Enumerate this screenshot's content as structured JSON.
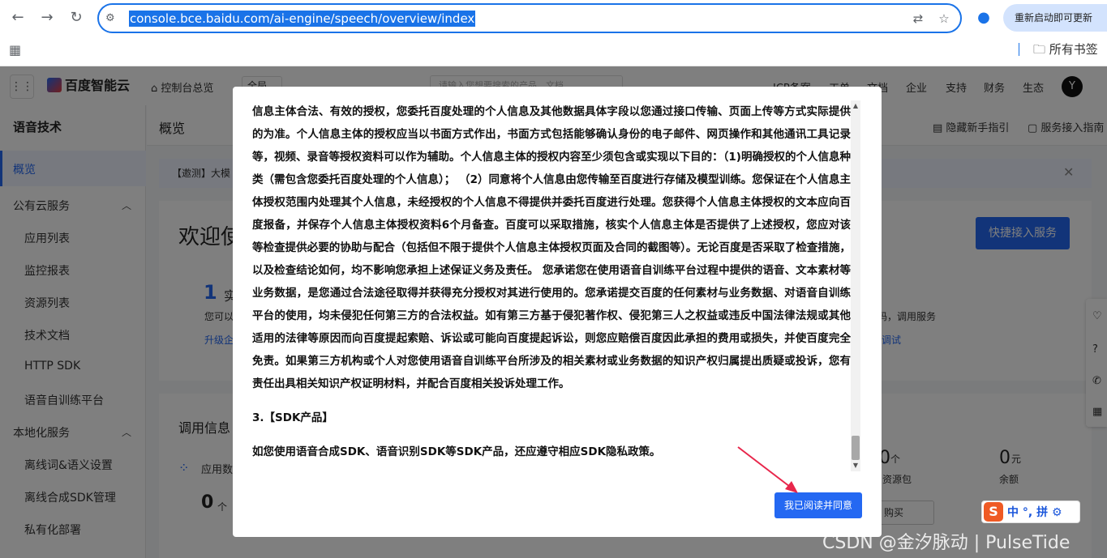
{
  "browser": {
    "url": "console.bce.baidu.com/ai-engine/speech/overview/index",
    "restart_label": "重新启动即可更新",
    "bookmarks_folder": "所有书签"
  },
  "topnav": {
    "brand": "百度智能云",
    "console_home": "控制台总览",
    "global_label": "全局",
    "search_placeholder": "请输入您想要搜索的产品、文档...",
    "links": [
      "ICP备案",
      "工单",
      "文档",
      "企业",
      "支持",
      "财务",
      "生态"
    ],
    "avatar_letter": "Y"
  },
  "sidebar": {
    "title": "语音技术",
    "active": "概览",
    "group_public": "公有云服务",
    "public_items": [
      "应用列表",
      "监控报表",
      "资源列表",
      "技术文档",
      "HTTP SDK",
      "语音自训练平台"
    ],
    "group_local": "本地化服务",
    "local_items": [
      "离线词&语义设置",
      "离线合成SDK管理",
      "私有化部署"
    ]
  },
  "content": {
    "title": "概览",
    "hide_guide": "隐藏新手指引",
    "service_guide": "服务接入指南",
    "notice": "【邀测】大模",
    "welcome": "欢迎使",
    "quick_access": "快捷接入服务",
    "step_num": "1",
    "step_title": "实",
    "step_desc": "您可以",
    "step_link": "升级企",
    "right_desc": "代码，调用服务",
    "right_link": "调试",
    "usage_title": "调用信息",
    "app_count_label": "应用数",
    "app_count_value": "0",
    "app_count_unit": "个",
    "pkg_value": "0",
    "pkg_unit": "个",
    "pkg_label": "资源包",
    "balance_value": "0",
    "balance_unit": "元",
    "balance_label": "余额",
    "buy_label": "购买"
  },
  "modal": {
    "paragraph": "信息主体合法、有效的授权，您委托百度处理的个人信息及其他数据具体字段以您通过接口传输、页面上传等方式实际提供的为准。个人信息主体的授权应当以书面方式作出，书面方式包括能够确认身份的电子邮件、网页操作和其他通讯工具记录等，视频、录音等授权资料可以作为辅助。个人信息主体的授权内容至少须包含或实现以下目的：（1)明确授权的个人信息种类（需包含您委托百度处理的个人信息）； （2）同意将个人信息由您传输至百度进行存储及模型训练。您保证在个人信息主体授权范围内处理其个人信息，未经授权的个人信息不得提供并委托百度进行处理。您获得个人信息主体授权的文本应向百度报备，并保存个人信息主体授权资料6个月备查。百度可以采取措施，核实个人信息主体是否提供了上述授权，您应对该等检查提供必要的协助与配合（包括但不限于提供个人信息主体授权页面及合同的截图等）。无论百度是否采取了检查措施，以及检查结论如何，均不影响您承担上述保证义务及责任。 您承诺您在使用语音自训练平台过程中提供的语音、文本素材等业务数据，是您通过合法途径取得并获得充分授权对其进行使用的。您承诺提交百度的任何素材与业务数据、对语音自训练平台的使用，均未侵犯任何第三方的合法权益。如有第三方基于侵犯著作权、侵犯第三人之权益或违反中国法律法规或其他适用的法律等原因而向百度提起索赔、诉讼或可能向百度提起诉讼，则您应赔偿百度因此承担的费用或损失，并使百度完全免责。如果第三方机构或个人对您使用语音自训练平台所涉及的相关素材或业务数据的知识产权归属提出质疑或投诉，您有责任出具相关知识产权证明材料，并配合百度相关投诉处理工作。",
    "section_title": "3.【SDK产品】",
    "sdk_paragraph": "如您使用语音合成SDK、语音识别SDK等SDK产品，还应遵守相应SDK隐私政策。",
    "agree_button": "我已阅读并同意"
  },
  "ime": {
    "logo": "S",
    "text": "中 °, 拼 ⚙"
  },
  "watermark": "CSDN @金汐脉动 | PulseTide"
}
